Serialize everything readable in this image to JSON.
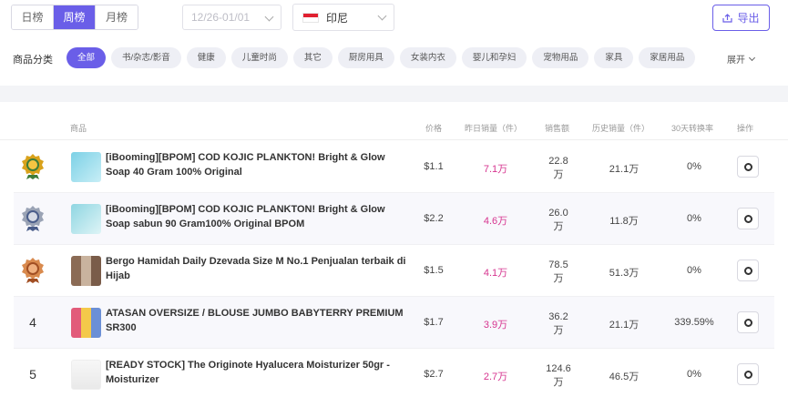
{
  "period_tabs": [
    {
      "label": "日榜",
      "active": false
    },
    {
      "label": "周榜",
      "active": true
    },
    {
      "label": "月榜",
      "active": false
    }
  ],
  "date_range": {
    "placeholder": "12/26-01/01"
  },
  "country": {
    "label": "印尼"
  },
  "export": {
    "label": "导出"
  },
  "categories": {
    "label": "商品分类",
    "items": [
      {
        "label": "全部",
        "active": true
      },
      {
        "label": "书/杂志/影音",
        "active": false
      },
      {
        "label": "健康",
        "active": false
      },
      {
        "label": "儿童时尚",
        "active": false
      },
      {
        "label": "其它",
        "active": false
      },
      {
        "label": "厨房用具",
        "active": false
      },
      {
        "label": "女装内衣",
        "active": false
      },
      {
        "label": "婴儿和孕妇",
        "active": false
      },
      {
        "label": "宠物用品",
        "active": false
      },
      {
        "label": "家具",
        "active": false
      },
      {
        "label": "家居用品",
        "active": false
      }
    ],
    "expand_label": "展开"
  },
  "table": {
    "headers": {
      "product": "商品",
      "price": "价格",
      "yesterday_sales": "昨日销量（件）",
      "sales_amount": "销售额",
      "history_sales": "历史销量（件）",
      "conversion": "30天转换率",
      "action": "操作"
    },
    "rows": [
      {
        "rank": "",
        "medal": "gold-medal-icon",
        "name": "[iBooming][BPOM] COD KOJIC PLANKTON! Bright & Glow Soap 40 Gram 100% Original",
        "price": "$1.1",
        "yesterday": "7.1万",
        "sales_num": "22.8",
        "sales_unit": "万",
        "history": "21.1万",
        "rate": "0%"
      },
      {
        "rank": "",
        "medal": "silver-medal-icon",
        "name": "[iBooming][BPOM] COD KOJIC PLANKTON! Bright & Glow Soap sabun 90 Gram100% Original BPOM",
        "price": "$2.2",
        "yesterday": "4.6万",
        "sales_num": "26.0",
        "sales_unit": "万",
        "history": "11.8万",
        "rate": "0%"
      },
      {
        "rank": "",
        "medal": "bronze-medal-icon",
        "name": "Bergo Hamidah Daily Dzevada Size M No.1 Penjualan terbaik di Hijab",
        "price": "$1.5",
        "yesterday": "4.1万",
        "sales_num": "78.5",
        "sales_unit": "万",
        "history": "51.3万",
        "rate": "0%"
      },
      {
        "rank": "4",
        "medal": "",
        "name": "ATASAN OVERSIZE / BLOUSE JUMBO BABYTERRY PREMIUM SR300",
        "price": "$1.7",
        "yesterday": "3.9万",
        "sales_num": "36.2",
        "sales_unit": "万",
        "history": "21.1万",
        "rate": "339.59%"
      },
      {
        "rank": "5",
        "medal": "",
        "name": "[READY STOCK] The Originote Hyalucera Moisturizer 50gr - Moisturizer",
        "price": "$2.7",
        "yesterday": "2.7万",
        "sales_num": "124.6",
        "sales_unit": "万",
        "history": "46.5万",
        "rate": "0%"
      }
    ]
  },
  "colors": {
    "accent": "#6a5ee8",
    "highlight": "#d6348f",
    "gold": "#d9a21b",
    "silver": "#9aa3b5",
    "bronze": "#d98a4e"
  }
}
